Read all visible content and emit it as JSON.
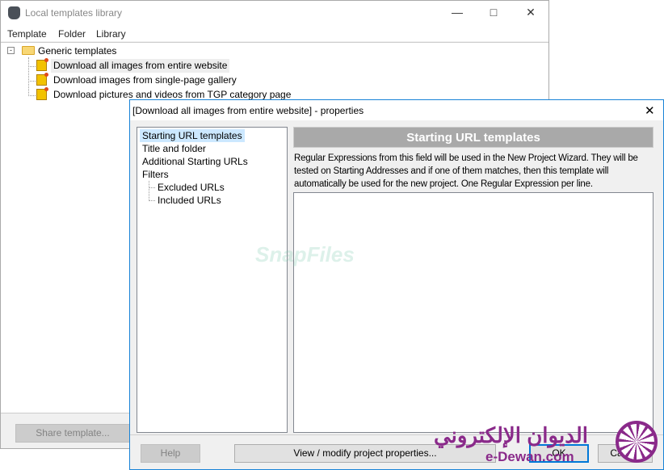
{
  "main_window": {
    "title": "Local templates library",
    "menu": [
      "Template",
      "Folder",
      "Library"
    ],
    "tree": {
      "root": "Generic templates",
      "items": [
        "Download all images from entire website",
        "Download images from single-page gallery",
        "Download pictures and videos from TGP category page"
      ]
    },
    "share_button": "Share template..."
  },
  "dialog": {
    "title": "[Download all images from entire website] - properties",
    "nav": [
      "Starting URL templates",
      "Title and folder",
      "Additional Starting URLs",
      "Filters",
      "Excluded URLs",
      "Included URLs"
    ],
    "selected_nav": "Starting URL templates",
    "header": "Starting URL templates",
    "description": "Regular Expressions from this field will be used in the New Project Wizard. They will be tested on Starting Addresses and if one of them matches, then this template will automatically be used for the new project. One Regular Expression per line.",
    "textarea_value": "",
    "buttons": {
      "help": "Help",
      "view": "View / modify project properties...",
      "ok": "OK",
      "cancel": "Cancel"
    }
  },
  "watermarks": {
    "snapfiles": "SnapFiles",
    "dewan_arabic": "الديوان الإلكتروني",
    "dewan_latin": "e-Dewan.com"
  },
  "colors": {
    "accent": "#1883d7",
    "header_bg": "#a9a9a9",
    "selection": "#cce8ff"
  }
}
